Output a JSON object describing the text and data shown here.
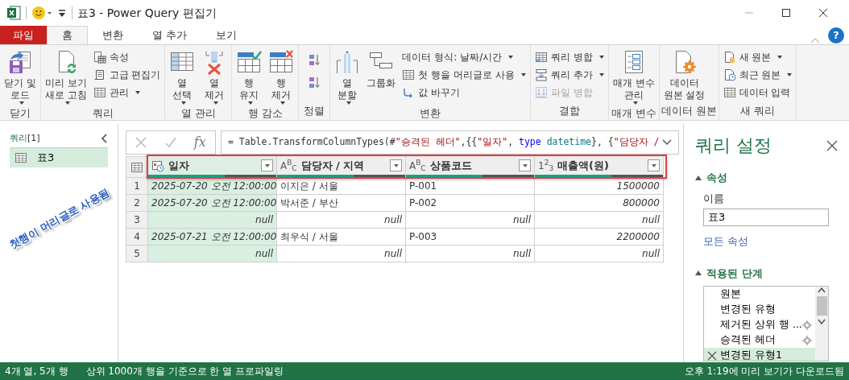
{
  "window": {
    "title": "표3 - Power Query 편집기"
  },
  "tabs": [
    {
      "label": "파일",
      "kind": "file",
      "selected": false
    },
    {
      "label": "홈",
      "kind": "tab",
      "selected": true
    },
    {
      "label": "변환",
      "kind": "tab",
      "selected": false
    },
    {
      "label": "열 추가",
      "kind": "tab",
      "selected": false
    },
    {
      "label": "보기",
      "kind": "tab",
      "selected": false
    }
  ],
  "help": "?",
  "ribbon": [
    {
      "label": "닫기",
      "items": [
        {
          "kind": "large",
          "label": "닫기 및\n로드",
          "dropdown": true
        }
      ]
    },
    {
      "label": "쿼리",
      "items": [
        {
          "kind": "large",
          "label": "미리 보기\n새로 고침",
          "dropdown": true
        },
        {
          "kind": "column",
          "items": [
            {
              "label": "속성",
              "dropdown": false
            },
            {
              "label": "고급 편집기",
              "dropdown": false
            },
            {
              "label": "관리",
              "dropdown": true
            }
          ]
        }
      ]
    },
    {
      "label": "열 관리",
      "items": [
        {
          "kind": "large",
          "label": "열\n선택",
          "dropdown": true
        },
        {
          "kind": "large",
          "label": "열\n제거",
          "dropdown": true
        }
      ]
    },
    {
      "label": "행 감소",
      "items": [
        {
          "kind": "large",
          "label": "행\n유지",
          "dropdown": true
        },
        {
          "kind": "large",
          "label": "행\n제거",
          "dropdown": true
        }
      ]
    },
    {
      "label": "정렬",
      "items": [
        {
          "kind": "sort"
        }
      ]
    },
    {
      "label": "변환",
      "items": [
        {
          "kind": "large",
          "label": "열\n분할",
          "dropdown": true
        },
        {
          "kind": "large",
          "label": "그룹화",
          "dropdown": false
        },
        {
          "kind": "column",
          "items": [
            {
              "label": "데이터 형식: 날짜/시간",
              "dropdown": true
            },
            {
              "label": "첫 행을 머리글로 사용",
              "dropdown": true
            },
            {
              "label": "값 바꾸기",
              "dropdown": false
            }
          ]
        }
      ]
    },
    {
      "label": "결합",
      "items": [
        {
          "kind": "column",
          "items": [
            {
              "label": "쿼리 병합",
              "dropdown": true,
              "disabled": false
            },
            {
              "label": "쿼리 추가",
              "dropdown": true,
              "disabled": false
            },
            {
              "label": "파일 병합",
              "dropdown": false,
              "disabled": true
            }
          ]
        }
      ]
    },
    {
      "label": "매개 변수",
      "items": [
        {
          "kind": "large",
          "label": "매개 변수\n관리",
          "dropdown": true
        }
      ]
    },
    {
      "label": "데이터 원본",
      "items": [
        {
          "kind": "large",
          "label": "데이터\n원본 설정",
          "dropdown": false
        }
      ]
    },
    {
      "label": "새 쿼리",
      "items": [
        {
          "kind": "column",
          "items": [
            {
              "label": "새 원본",
              "dropdown": true
            },
            {
              "label": "최근 원본",
              "dropdown": true
            },
            {
              "label": "데이터 입력",
              "dropdown": false
            }
          ]
        }
      ]
    }
  ],
  "queries": {
    "title": "쿼리",
    "count": "[1]",
    "items": [
      {
        "label": "표3",
        "selected": true
      }
    ]
  },
  "formula": {
    "fx": "fx",
    "segments": [
      {
        "text": "= Table.TransformColumnTypes(#",
        "kind": "plain"
      },
      {
        "text": "\"승격된 헤더\"",
        "kind": "string"
      },
      {
        "text": ",{{",
        "kind": "plain"
      },
      {
        "text": "\"일자\"",
        "kind": "string"
      },
      {
        "text": ", ",
        "kind": "plain"
      },
      {
        "text": "type",
        "kind": "keyword"
      },
      {
        "text": " datetime",
        "kind": "type"
      },
      {
        "text": "}, {",
        "kind": "plain"
      },
      {
        "text": "\"담당자 /",
        "kind": "string"
      }
    ]
  },
  "table": {
    "header_highlight": true,
    "columns": [
      {
        "name": "일자",
        "selected": true,
        "level": 0.6
      },
      {
        "name": "담당자 / 지역",
        "type_label": "A$^{B}$$_{C}$",
        "selected": false,
        "level": 0.6
      },
      {
        "name": "상품코드",
        "type_label": "A$^{B}$$_{C}$",
        "selected": false,
        "level": 0.6
      },
      {
        "name": "매출액(원)",
        "type_label": "1$^{2}$$_{3}$",
        "selected": false,
        "level": 0.6
      }
    ],
    "rows": [
      {
        "number": "1",
        "cells": [
          {
            "value": "2025-07-20 오전 12:00:00",
            "kind": "datetime"
          },
          {
            "value": "이지은 / 서울",
            "kind": "text"
          },
          {
            "value": "P-001",
            "kind": "text"
          },
          {
            "value": "1500000",
            "kind": "number"
          }
        ]
      },
      {
        "number": "2",
        "cells": [
          {
            "value": "2025-07-20 오전 12:00:00",
            "kind": "datetime"
          },
          {
            "value": "박서준 / 부산",
            "kind": "text"
          },
          {
            "value": "P-002",
            "kind": "text"
          },
          {
            "value": "800000",
            "kind": "number"
          }
        ]
      },
      {
        "number": "3",
        "cells": [
          {
            "value": "null",
            "kind": "null"
          },
          {
            "value": "null",
            "kind": "null"
          },
          {
            "value": "null",
            "kind": "null"
          },
          {
            "value": "null",
            "kind": "null"
          }
        ]
      },
      {
        "number": "4",
        "cells": [
          {
            "value": "2025-07-21 오전 12:00:00",
            "kind": "datetime"
          },
          {
            "value": "최우식 / 서울",
            "kind": "text"
          },
          {
            "value": "P-003",
            "kind": "text"
          },
          {
            "value": "2200000",
            "kind": "number"
          }
        ]
      },
      {
        "number": "5",
        "cells": [
          {
            "value": "null",
            "kind": "null"
          },
          {
            "value": "null",
            "kind": "null"
          },
          {
            "value": "null",
            "kind": "null"
          },
          {
            "value": "null",
            "kind": "null"
          }
        ]
      }
    ]
  },
  "callout": {
    "text": "첫행이 머리글로 사용됨"
  },
  "settings": {
    "title": "쿼리 설정",
    "properties": {
      "title": "속성",
      "expanded": true,
      "name_label": "이름",
      "name_value": "표3",
      "all_link": "모든 속성"
    },
    "steps": {
      "title": "적용된 단계",
      "expanded": true,
      "items": [
        {
          "label": "원본",
          "settings": false,
          "selected": false
        },
        {
          "label": "변경된 유형",
          "settings": false,
          "selected": false
        },
        {
          "label": "제거된 상위 행 ...",
          "settings": true,
          "selected": false
        },
        {
          "label": "승격된 헤더",
          "settings": true,
          "selected": false
        },
        {
          "label": "변경된 유형1",
          "settings": false,
          "selected": true
        }
      ]
    }
  },
  "status_bar": {
    "left": [
      "4개 열, 5개 행",
      "상위 1000개 행을 기준으로 한 열 프로파일링"
    ],
    "right": "오후 1:19에 미리 보기가 다운로드됨"
  }
}
